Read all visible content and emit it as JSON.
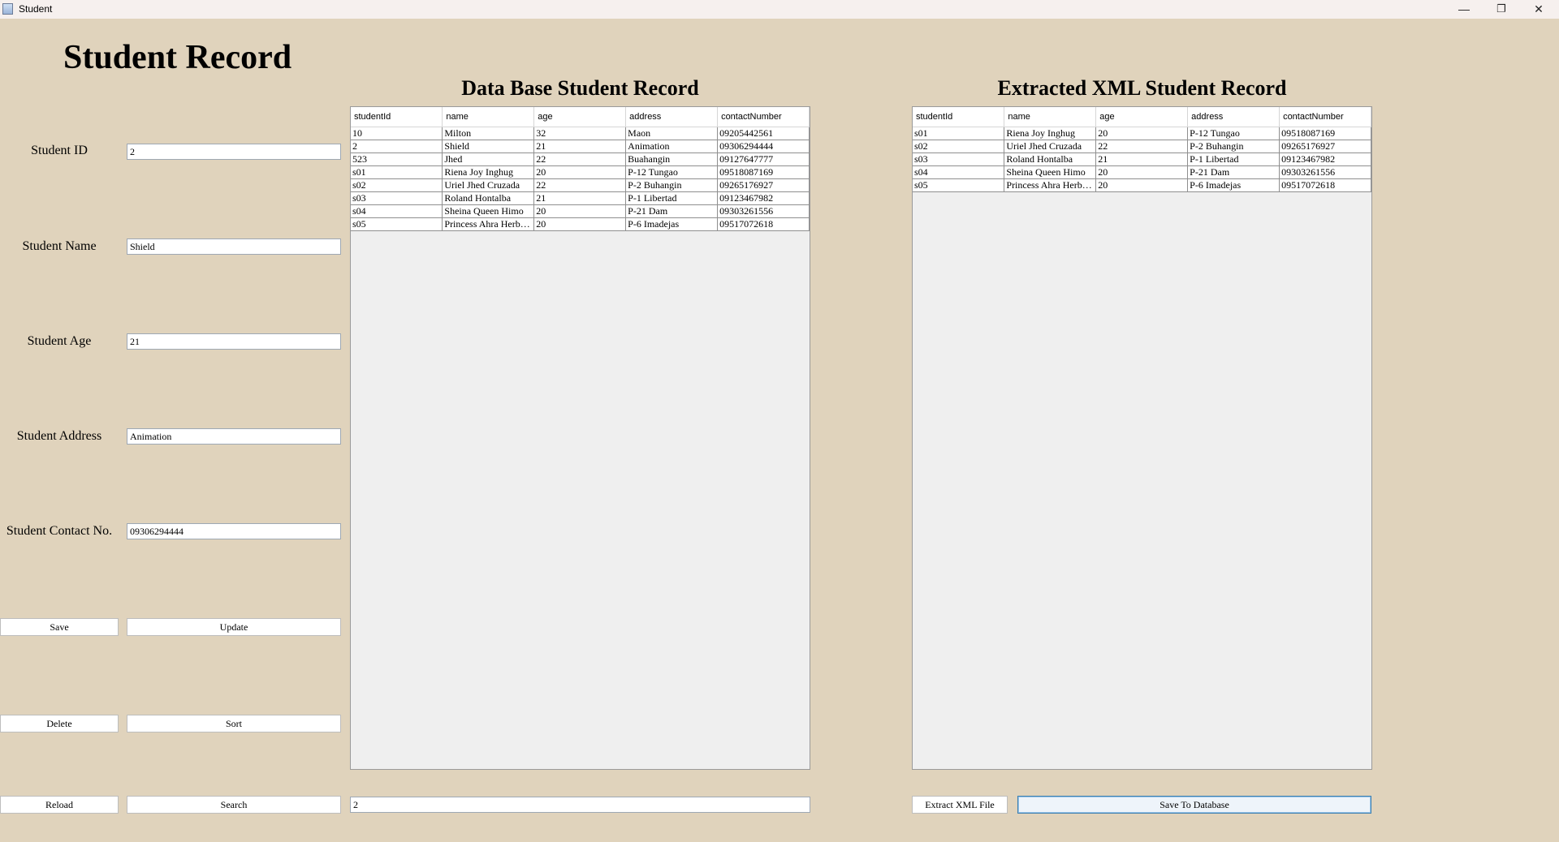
{
  "window": {
    "title": "Student",
    "controls": {
      "minimize": "—",
      "restore": "❐",
      "close": "✕"
    }
  },
  "page_title": "Student Record",
  "form": {
    "fields": [
      {
        "label": "Student ID",
        "value": "2"
      },
      {
        "label": "Student Name",
        "value": "Shield"
      },
      {
        "label": "Student Age",
        "value": "21"
      },
      {
        "label": "Student Address",
        "value": "Animation"
      },
      {
        "label": "Student Contact No.",
        "value": "09306294444"
      }
    ]
  },
  "buttons": {
    "save": "Save",
    "update": "Update",
    "delete": "Delete",
    "sort": "Sort",
    "reload": "Reload",
    "search": "Search",
    "extract_xml": "Extract XML File",
    "save_to_db": "Save To Database"
  },
  "search": {
    "value": "2"
  },
  "db_table": {
    "title": "Data Base Student Record",
    "columns": [
      "studentId",
      "name",
      "age",
      "address",
      "contactNumber"
    ],
    "rows": [
      [
        "10",
        "Milton",
        "32",
        "Maon",
        "09205442561"
      ],
      [
        "2",
        "Shield",
        "21",
        "Animation",
        "09306294444"
      ],
      [
        "523",
        "Jhed",
        "22",
        "Buahangin",
        "09127647777"
      ],
      [
        "s01",
        "Riena Joy Inghug",
        "20",
        "P-12 Tungao",
        "09518087169"
      ],
      [
        "s02",
        "Uriel Jhed Cruzada",
        "22",
        "P-2 Buhangin",
        "09265176927"
      ],
      [
        "s03",
        "Roland Hontalba",
        "21",
        "P-1 Libertad",
        "09123467982"
      ],
      [
        "s04",
        "Sheina Queen Himo",
        "20",
        "P-21 Dam",
        "09303261556"
      ],
      [
        "s05",
        "Princess Ahra Herbo...",
        "20",
        "P-6 Imadejas",
        "09517072618"
      ]
    ]
  },
  "xml_table": {
    "title": "Extracted XML Student Record",
    "columns": [
      "studentId",
      "name",
      "age",
      "address",
      "contactNumber"
    ],
    "rows": [
      [
        "s01",
        "Riena Joy Inghug",
        "20",
        "P-12 Tungao",
        "09518087169"
      ],
      [
        "s02",
        "Uriel Jhed Cruzada",
        "22",
        "P-2 Buhangin",
        "09265176927"
      ],
      [
        "s03",
        "Roland Hontalba",
        "21",
        "P-1 Libertad",
        "09123467982"
      ],
      [
        "s04",
        "Sheina Queen Himo",
        "20",
        "P-21 Dam",
        "09303261556"
      ],
      [
        "s05",
        "Princess Ahra Herbo...",
        "20",
        "P-6 Imadejas",
        "09517072618"
      ]
    ]
  }
}
